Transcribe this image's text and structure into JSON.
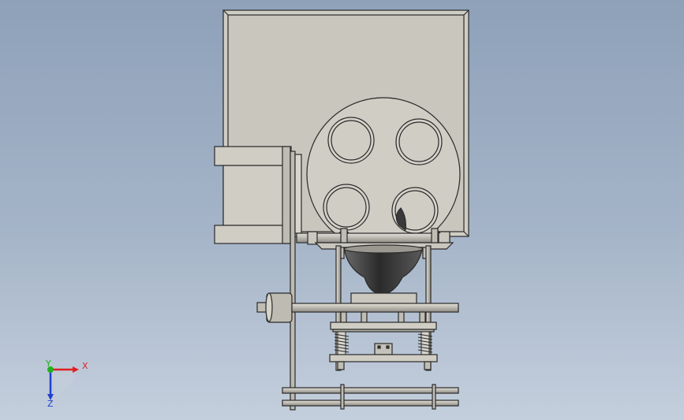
{
  "triad": {
    "x_label": "X",
    "y_label": "Y",
    "z_label": "Z",
    "x_color": "#e02020",
    "y_color": "#20b020",
    "z_color": "#2040d0"
  },
  "colors": {
    "part_fill": "#cfcdc4",
    "part_stroke": "#2a2a2a",
    "shade_dark": "#3c3c3c",
    "background_top": "#8ea1b9",
    "background_bottom": "#c4cfdd"
  },
  "icons": [
    "coordinate-triad-icon"
  ]
}
